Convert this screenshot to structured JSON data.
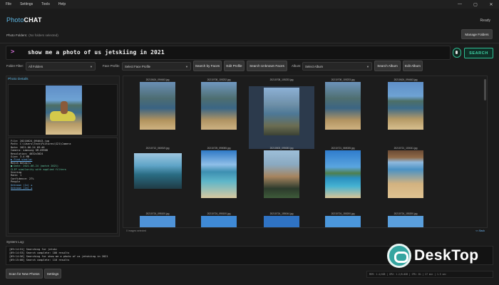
{
  "menu": [
    "File",
    "Settings",
    "Tools",
    "Help"
  ],
  "window_controls": [
    "—",
    "▢",
    "✕"
  ],
  "brand": {
    "part1": "Photo",
    "part2": "CHAT"
  },
  "status_ready": "Ready",
  "photo_folders": {
    "label": "Photo Folders:",
    "value": "(No folders selected)",
    "manage_button": "Manage Folders"
  },
  "search": {
    "prompt": ">",
    "query": "show me a photo of us jetskiing in 2021",
    "button": "SEARCH"
  },
  "filters": {
    "folder_label": "Folder Filter:",
    "folder_value": "All Folders",
    "profile_label": "Face Profile:",
    "profile_value": "Select Face Profile",
    "search_faces": "Search by Faces",
    "edit_profile": "Edit Profile",
    "search_unknown": "Search Unknown Faces",
    "album_label": "Album:",
    "album_value": "Select Album",
    "search_album": "Search Album",
    "edit_album": "Edit Album"
  },
  "photo_details": {
    "title": "Photo Details",
    "info_lines": [
      {
        "text": "File: 20210624_094643.jpg",
        "style": ""
      },
      {
        "text": "Path: C:\\Users\\Tech\\Pictures\\S21\\Camera",
        "style": ""
      },
      {
        "text": "Date: 2021-06-24 09:46",
        "style": ""
      },
      {
        "text": "Camera: samsung SM-G996B",
        "style": ""
      },
      {
        "text": "Resolution: 4032x3024",
        "style": ""
      },
      {
        "text": "Size: 3.4 MB",
        "style": ""
      },
      {
        "text": "  ▶ Find similar",
        "style": "link"
      },
      {
        "text": "Match Details",
        "style": ""
      },
      {
        "text": " ■ Date: 2021-06-24  (match 2021)",
        "style": "green"
      },
      {
        "text": "CLIP similarity with applied filters",
        "style": "green"
      },
      {
        "text": "Scoring",
        "style": ""
      },
      {
        "text": "Rank: 1",
        "style": ""
      },
      {
        "text": "Confidence: 27%",
        "style": ""
      },
      {
        "text": "People",
        "style": ""
      },
      {
        "text": "Unknown (1x) ✚",
        "style": "link"
      },
      {
        "text": "Unknown (2x) ✚",
        "style": "link"
      }
    ]
  },
  "grid": {
    "row1": [
      "20210624_094643.jpg",
      "20210708_105232.jpg",
      "20210708_105233.jpg",
      "20210708_105233.jpg",
      "20210624_094643.jpg"
    ],
    "row2": [
      "20210712_060519.jpg",
      "20210725_095055.jpg",
      "20210803_095083.jpg",
      "20210721_065035.jpg",
      "20210721_100041.jpg"
    ],
    "row3": [
      "20210724_095100.jpg",
      "20210724_095100.jpg",
      "20210724_155044.jpg",
      "20210724_155200.jpg",
      "20210724_155200.jpg"
    ],
    "status": "0 images selected",
    "back": "<< Back"
  },
  "log": {
    "label": "System Log:",
    "lines": [
      "[09:14:51] Searching for jetski",
      "[09:14:53] Search complete: 100 results",
      "[09:14:56] Searching for show me a photo of us jetskiing in 2021",
      "[09:15:00] Search complete: 110 results"
    ]
  },
  "bottom": {
    "scan": "Scan for New Photos",
    "settings": "Settings"
  },
  "statusbar": "MEM: 1.4/4GB | GPU: 1.2/8.0GB | CPU: 8% | 27 min | 1.5 sec",
  "watermark": "DeskTop"
}
